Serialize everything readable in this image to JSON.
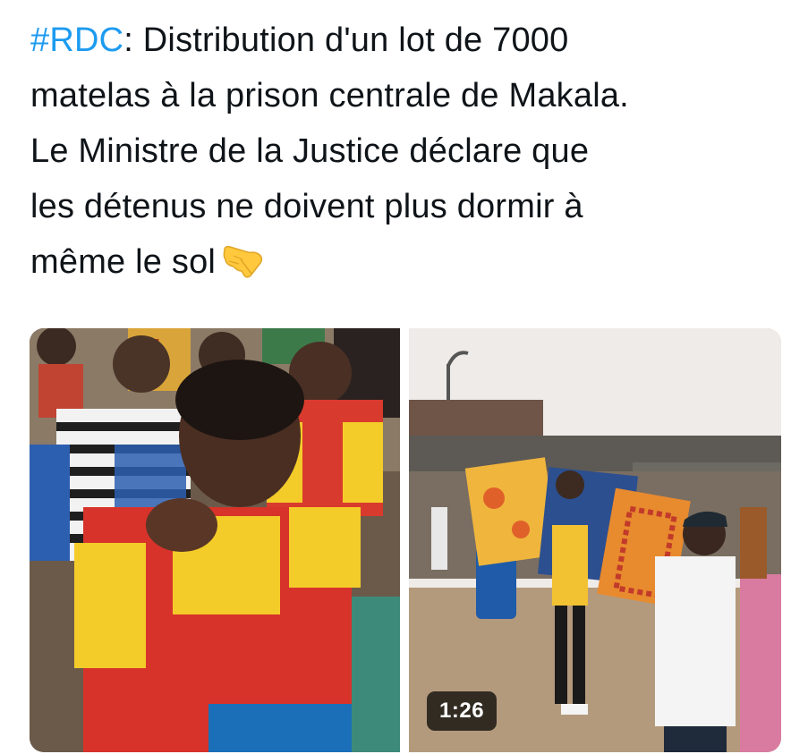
{
  "tweet": {
    "hashtag": "#RDC",
    "text_after_hashtag": ": Distribution d'un lot de 7000",
    "lines": [
      "matelas à la prison centrale de Makala.",
      "Le Ministre de la Justice déclare que",
      "les détenus ne doivent plus dormir à",
      "même le sol"
    ],
    "emoji": "backhand-index-pointing-down-emoji"
  },
  "media": {
    "left_photo_description_icon": "photo-women-detainees",
    "right_video": {
      "duration": "1:26"
    }
  },
  "colors": {
    "hashtag": "#1d9bf0",
    "text": "#0f1419",
    "background": "#ffffff"
  }
}
